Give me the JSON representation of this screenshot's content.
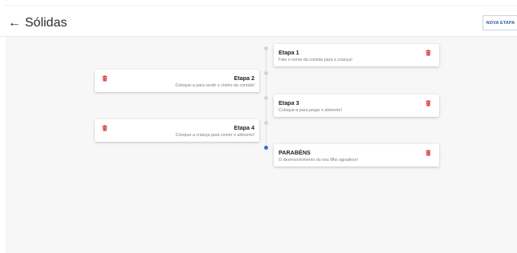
{
  "header": {
    "title": "Sólidas",
    "back_icon": "arrow-left-icon",
    "new_button": "NOVA ETAPA"
  },
  "steps": [
    {
      "title": "Etapa 1",
      "description": "Fale o nome da comida para a criança!",
      "side": "right"
    },
    {
      "title": "Etapa 2",
      "description": "Coloque-a para sentir o cheiro da comida!",
      "side": "left"
    },
    {
      "title": "Etapa 3",
      "description": "Coloque-a para pegar o alimento!",
      "side": "right"
    },
    {
      "title": "Etapa 4",
      "description": "Coloque a criança para comer o alimento!",
      "side": "left"
    },
    {
      "title": "PARABÉNS",
      "description": "O desenvolvimento do seu filho agradece!",
      "side": "right"
    }
  ],
  "colors": {
    "accent": "#2f5aa5",
    "active_dot": "#3c6fc5",
    "inactive_dot": "#cfd5df",
    "trash": "#d32f2f"
  }
}
